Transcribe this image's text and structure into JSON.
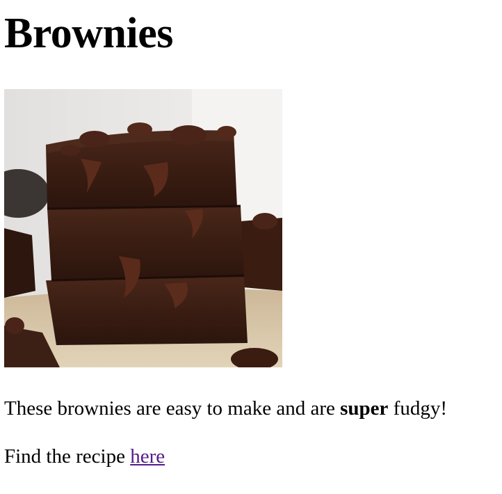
{
  "page": {
    "title": "Brownies",
    "image": {
      "alt": "brownie-stack-photo",
      "colors": {
        "background": "#e9e7e5",
        "parchment": "#d8c6a6",
        "brownie": "#3b1e14",
        "brownie_dark": "#2a140d",
        "chocolate_chip": "#4a2418"
      }
    },
    "description": {
      "text_before": "These brownies are easy to make and are ",
      "emphasis": "super",
      "text_after": " fudgy!"
    },
    "recipe": {
      "text_before": "Find the recipe ",
      "link_text": "here",
      "link_color": "#551a8b"
    }
  }
}
